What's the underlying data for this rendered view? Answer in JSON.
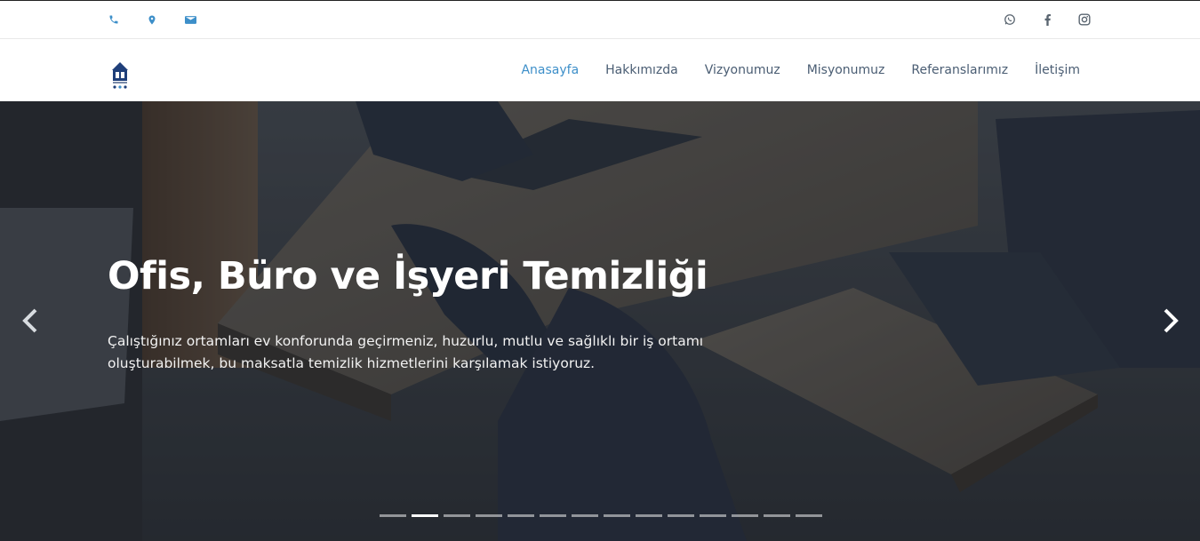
{
  "topbar": {
    "left_icons": [
      "phone-icon",
      "map-marker-icon",
      "envelope-icon"
    ],
    "right_icons": [
      "whatsapp-icon",
      "facebook-icon",
      "instagram-icon"
    ],
    "icon_color_left": "#3d8fc9",
    "icon_color_right": "#5a6570"
  },
  "nav": {
    "items": [
      {
        "label": "Anasayfa",
        "active": true
      },
      {
        "label": "Hakkımızda",
        "active": false
      },
      {
        "label": "Vizyonumuz",
        "active": false
      },
      {
        "label": "Misyonumuz",
        "active": false
      },
      {
        "label": "Referanslarımız",
        "active": false
      },
      {
        "label": "İletişim",
        "active": false
      }
    ],
    "active_color": "#3d8fc9",
    "text_color": "#4a5d73"
  },
  "hero": {
    "title": "Ofis, Büro ve İşyeri Temizliği",
    "text": "Çalıştığınız ortamları ev konforunda geçirmeniz, huzurlu, mutlu ve sağlıklı bir iş ortamı oluşturabilmek, bu maksatla temizlik hizmetlerini karşılamak istiyoruz.",
    "slide_count": 14,
    "active_slide": 2
  }
}
